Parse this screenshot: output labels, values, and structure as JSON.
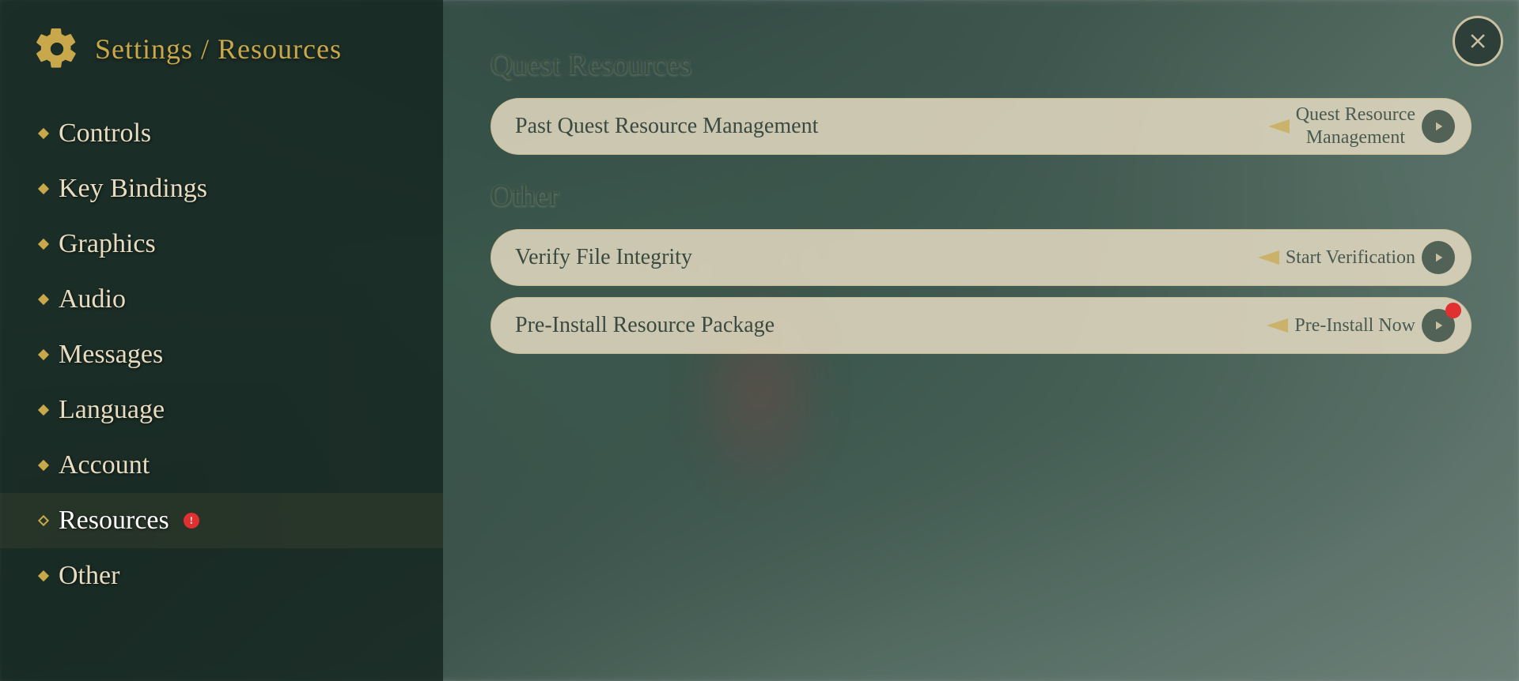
{
  "header": {
    "title": "Settings / Resources",
    "close_label": "X"
  },
  "sidebar": {
    "items": [
      {
        "id": "controls",
        "label": "Controls",
        "active": false,
        "bullet": "solid",
        "badge": false
      },
      {
        "id": "key-bindings",
        "label": "Key Bindings",
        "active": false,
        "bullet": "solid",
        "badge": false
      },
      {
        "id": "graphics",
        "label": "Graphics",
        "active": false,
        "bullet": "solid",
        "badge": false
      },
      {
        "id": "audio",
        "label": "Audio",
        "active": false,
        "bullet": "solid",
        "badge": false
      },
      {
        "id": "messages",
        "label": "Messages",
        "active": false,
        "bullet": "solid",
        "badge": false
      },
      {
        "id": "language",
        "label": "Language",
        "active": false,
        "bullet": "solid",
        "badge": false
      },
      {
        "id": "account",
        "label": "Account",
        "active": false,
        "bullet": "solid",
        "badge": false
      },
      {
        "id": "resources",
        "label": "Resources",
        "active": true,
        "bullet": "open",
        "badge": true
      },
      {
        "id": "other",
        "label": "Other",
        "active": false,
        "bullet": "solid",
        "badge": false
      }
    ]
  },
  "content": {
    "sections": [
      {
        "id": "quest-resources",
        "title": "Quest Resources",
        "items": [
          {
            "id": "past-quest",
            "left_label": "Past Quest Resource Management",
            "right_label": "Quest Resource\nManagement",
            "has_badge": false
          }
        ]
      },
      {
        "id": "other",
        "title": "Other",
        "items": [
          {
            "id": "verify-file",
            "left_label": "Verify File Integrity",
            "right_label": "Start Verification",
            "has_badge": false
          },
          {
            "id": "pre-install",
            "left_label": "Pre-Install Resource Package",
            "right_label": "Pre-Install Now",
            "has_badge": true
          }
        ]
      }
    ]
  }
}
